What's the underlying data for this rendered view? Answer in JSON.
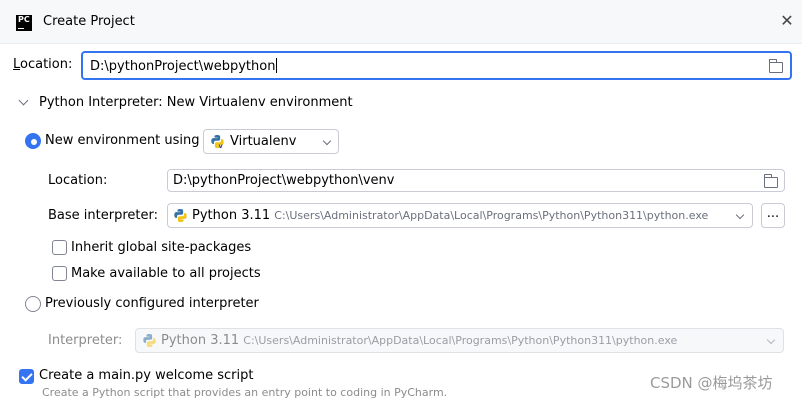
{
  "window": {
    "title": "Create Project",
    "app_icon_text": "PC"
  },
  "location": {
    "label_mnemonic": "L",
    "label_rest": "ocation:",
    "value": "D:\\pythonProject\\webpython"
  },
  "interpreter_section": {
    "title": "Python Interpreter: New Virtualenv environment",
    "new_env": {
      "label": "New environment using",
      "selected": true,
      "tool": "Virtualenv",
      "location_label": "Location:",
      "location_value": "D:\\pythonProject\\webpython\\venv",
      "base_label": "Base interpreter:",
      "base_version": "Python 3.11",
      "base_path": "C:\\Users\\Administrator\\AppData\\Local\\Programs\\Python\\Python311\\python.exe",
      "browse_label": "...",
      "inherit_label": "Inherit global site-packages",
      "inherit_checked": false,
      "available_label": "Make available to all projects",
      "available_checked": false
    },
    "previous": {
      "label": "Previously configured interpreter",
      "selected": false,
      "interpreter_label": "Interpreter:",
      "version": "Python 3.11",
      "path": "C:\\Users\\Administrator\\AppData\\Local\\Programs\\Python\\Python311\\python.exe"
    }
  },
  "welcome": {
    "label": "Create a main.py welcome script",
    "checked": true,
    "hint": "Create a Python script that provides an entry point to coding in PyCharm."
  },
  "watermark": "CSDN @梅坞茶坊",
  "colors": {
    "accent": "#3574f0",
    "border": "#c9ccd6",
    "muted": "#8c8c8c"
  }
}
